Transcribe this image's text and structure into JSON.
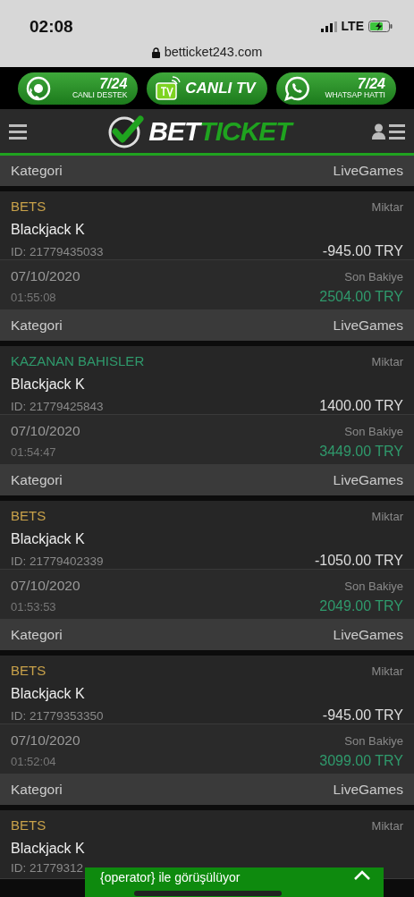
{
  "status_bar": {
    "time": "02:08",
    "network": "LTE"
  },
  "address_bar": {
    "url": "betticket243.com"
  },
  "banner": [
    {
      "kind": "support",
      "title": "7/24",
      "subtitle": "CANLI DESTEK"
    },
    {
      "kind": "tv",
      "title": "CANLI TV"
    },
    {
      "kind": "whatsapp",
      "title": "7/24",
      "subtitle": "WHATSAP HATTI"
    }
  ],
  "header": {
    "logo_part1": "BET",
    "logo_part2": "TICKET"
  },
  "top_category": {
    "label": "Kategori",
    "value": "LiveGames"
  },
  "transactions": [
    {
      "kind": "bet",
      "type": "BETS",
      "amount_label": "Miktar",
      "game": "Blackjack K",
      "id": "ID: 21779435033",
      "amount": "-945.00 TRY",
      "date": "07/10/2020",
      "time": "01:55:08",
      "balance_label": "Son Bakiye",
      "balance": "2504.00 TRY",
      "category_label": "Kategori",
      "category": "LiveGames"
    },
    {
      "kind": "win",
      "type": "KAZANAN BAHISLER",
      "amount_label": "Miktar",
      "game": "Blackjack K",
      "id": "ID: 21779425843",
      "amount": "1400.00 TRY",
      "date": "07/10/2020",
      "time": "01:54:47",
      "balance_label": "Son Bakiye",
      "balance": "3449.00 TRY",
      "category_label": "Kategori",
      "category": "LiveGames"
    },
    {
      "kind": "bet",
      "type": "BETS",
      "amount_label": "Miktar",
      "game": "Blackjack K",
      "id": "ID: 21779402339",
      "amount": "-1050.00 TRY",
      "date": "07/10/2020",
      "time": "01:53:53",
      "balance_label": "Son Bakiye",
      "balance": "2049.00 TRY",
      "category_label": "Kategori",
      "category": "LiveGames"
    },
    {
      "kind": "bet",
      "type": "BETS",
      "amount_label": "Miktar",
      "game": "Blackjack K",
      "id": "ID: 21779353350",
      "amount": "-945.00 TRY",
      "date": "07/10/2020",
      "time": "01:52:04",
      "balance_label": "Son Bakiye",
      "balance": "3099.00 TRY",
      "category_label": "Kategori",
      "category": "LiveGames"
    },
    {
      "kind": "bet",
      "type": "BETS",
      "amount_label": "Miktar",
      "game": "Blackjack K",
      "id": "ID: 21779312"
    }
  ],
  "chat_bar": {
    "text": "{operator} ile görüşülüyor"
  }
}
